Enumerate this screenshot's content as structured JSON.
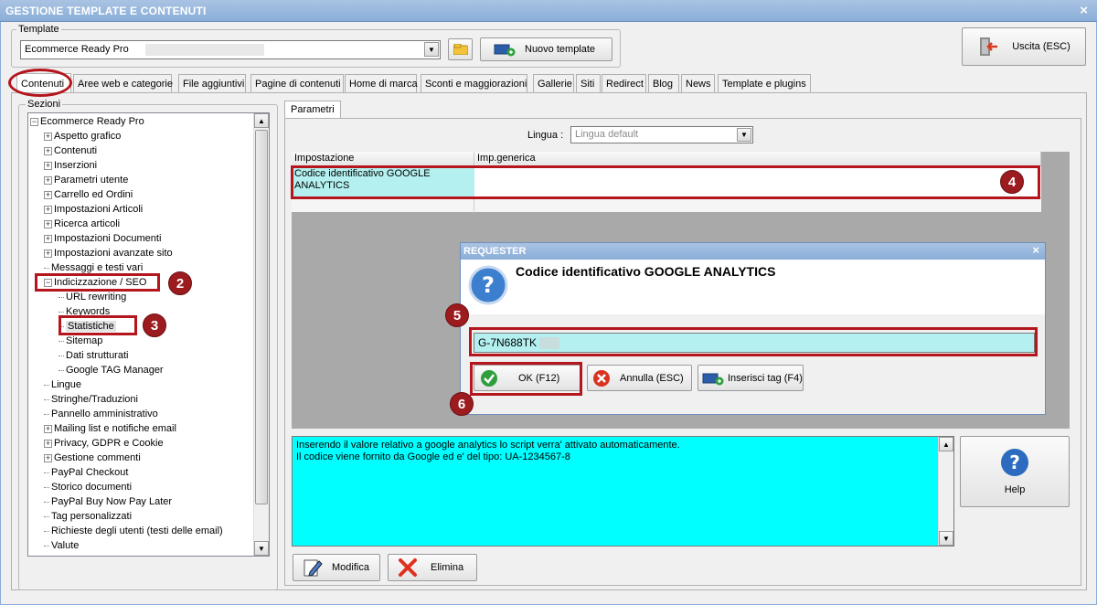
{
  "window": {
    "title": "GESTIONE TEMPLATE E CONTENUTI",
    "close_glyph": "×"
  },
  "template_group": {
    "label": "Template",
    "selected": "Ecommerce Ready Pro",
    "new_template_label": "Nuovo template"
  },
  "exit_button": {
    "label": "Uscita (ESC)"
  },
  "tabs": [
    {
      "label": "Contenuti"
    },
    {
      "label": "Aree web e categorie"
    },
    {
      "label": "File aggiuntivi"
    },
    {
      "label": "Pagine di contenuti"
    },
    {
      "label": "Home di marca"
    },
    {
      "label": "Sconti e maggiorazioni"
    },
    {
      "label": "Gallerie"
    },
    {
      "label": "Siti"
    },
    {
      "label": "Redirect"
    },
    {
      "label": "Blog"
    },
    {
      "label": "News"
    },
    {
      "label": "Template e plugins"
    }
  ],
  "sections": {
    "label": "Sezioni",
    "tree": [
      {
        "label": "Ecommerce Ready Pro",
        "level": 0,
        "exp": "−"
      },
      {
        "label": "Aspetto grafico",
        "level": 1,
        "exp": "+"
      },
      {
        "label": "Contenuti",
        "level": 1,
        "exp": "+"
      },
      {
        "label": "Inserzioni",
        "level": 1,
        "exp": "+"
      },
      {
        "label": "Parametri utente",
        "level": 1,
        "exp": "+"
      },
      {
        "label": "Carrello ed Ordini",
        "level": 1,
        "exp": "+"
      },
      {
        "label": "Impostazioni Articoli",
        "level": 1,
        "exp": "+"
      },
      {
        "label": "Ricerca articoli",
        "level": 1,
        "exp": "+"
      },
      {
        "label": "Impostazioni Documenti",
        "level": 1,
        "exp": "+"
      },
      {
        "label": "Impostazioni avanzate sito",
        "level": 1,
        "exp": "+"
      },
      {
        "label": "Messaggi e testi vari",
        "level": 1,
        "exp": ""
      },
      {
        "label": "Indicizzazione / SEO",
        "level": 1,
        "exp": "−"
      },
      {
        "label": "URL rewriting",
        "level": 2,
        "exp": ""
      },
      {
        "label": "Keywords",
        "level": 2,
        "exp": ""
      },
      {
        "label": "Statistiche",
        "level": 2,
        "exp": "",
        "selected": true
      },
      {
        "label": "Sitemap",
        "level": 2,
        "exp": ""
      },
      {
        "label": "Dati strutturati",
        "level": 2,
        "exp": ""
      },
      {
        "label": "Google TAG Manager",
        "level": 2,
        "exp": ""
      },
      {
        "label": "Lingue",
        "level": 1,
        "exp": ""
      },
      {
        "label": "Stringhe/Traduzioni",
        "level": 1,
        "exp": ""
      },
      {
        "label": "Pannello amministrativo",
        "level": 1,
        "exp": ""
      },
      {
        "label": "Mailing list e notifiche email",
        "level": 1,
        "exp": "+"
      },
      {
        "label": "Privacy, GDPR e Cookie",
        "level": 1,
        "exp": "+"
      },
      {
        "label": "Gestione commenti",
        "level": 1,
        "exp": "+"
      },
      {
        "label": "PayPal Checkout",
        "level": 1,
        "exp": ""
      },
      {
        "label": "Storico documenti",
        "level": 1,
        "exp": ""
      },
      {
        "label": "PayPal Buy Now Pay Later",
        "level": 1,
        "exp": ""
      },
      {
        "label": "Tag personalizzati",
        "level": 1,
        "exp": ""
      },
      {
        "label": "Richieste degli utenti (testi delle email)",
        "level": 1,
        "exp": ""
      },
      {
        "label": "Valute",
        "level": 1,
        "exp": ""
      }
    ]
  },
  "params": {
    "tab_label": "Parametri",
    "language_label": "Lingua :",
    "language_value": "Lingua default",
    "grid_headers": [
      "Impostazione",
      "Imp.generica"
    ],
    "row_setting": "Codice identificativo GOOGLE ANALYTICS",
    "row_value": ""
  },
  "requester": {
    "title": "REQUESTER",
    "question": "Codice identificativo GOOGLE ANALYTICS",
    "input_value": "G-7N688TK",
    "ok_label": "OK (F12)",
    "cancel_label": "Annulla (ESC)",
    "insert_tag_label": "Inserisci tag (F4)"
  },
  "help_text": {
    "line1": "Inserendo il valore relativo a google analytics lo script verra' attivato automaticamente.",
    "line2": "Il codice viene fornito da Google ed e' del tipo: UA-1234567-8"
  },
  "help_button": {
    "label": "Help"
  },
  "bottom_buttons": {
    "edit_label": "Modifica",
    "delete_label": "Elimina"
  },
  "annotations": {
    "b2": "2",
    "b3": "3",
    "b4": "4",
    "b5": "5",
    "b6": "6"
  },
  "colors": {
    "accent_red": "#b5151c",
    "highlight_cyan": "#00ffff",
    "cell_cyan": "#b4f0f0",
    "titlebar": "#8aaed8"
  }
}
